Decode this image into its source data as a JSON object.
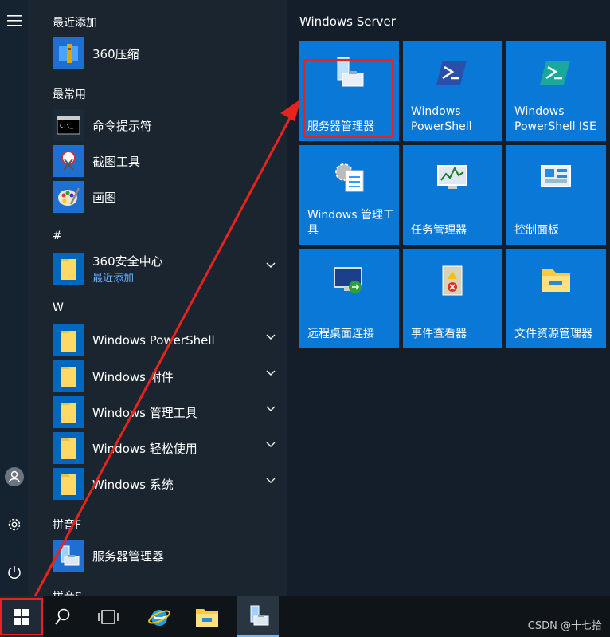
{
  "sidebar": {
    "icons": [
      "hamburger-icon",
      "user-icon",
      "gear-icon",
      "power-icon"
    ]
  },
  "applist": {
    "recent_header": "最近添加",
    "recent_items": [
      {
        "label": "360压缩",
        "icon": "archive-icon"
      }
    ],
    "most_used_header": "最常用",
    "most_used_items": [
      {
        "label": "命令提示符",
        "icon": "cmd-icon"
      },
      {
        "label": "截图工具",
        "icon": "snipping-icon"
      },
      {
        "label": "画图",
        "icon": "paint-icon"
      }
    ],
    "hash_header": "#",
    "hash_items": [
      {
        "label": "360安全中心",
        "sub": "最近添加"
      }
    ],
    "w_header": "W",
    "w_items": [
      {
        "label": "Windows PowerShell"
      },
      {
        "label": "Windows 附件"
      },
      {
        "label": "Windows 管理工具"
      },
      {
        "label": "Windows 轻松使用"
      },
      {
        "label": "Windows 系统"
      }
    ],
    "pinyin_f_header": "拼音F",
    "pinyin_f_items": [
      {
        "label": "服务器管理器"
      }
    ],
    "pinyin_s_header": "拼音S"
  },
  "tiles": {
    "group_title": "Windows Server",
    "items": [
      {
        "label": "服务器管理器",
        "icon": "server-manager-icon",
        "highlighted": true
      },
      {
        "label": "Windows PowerShell",
        "icon": "powershell-icon"
      },
      {
        "label": "Windows PowerShell ISE",
        "icon": "powershell-ise-icon"
      },
      {
        "label": "Windows 管理工具",
        "icon": "admin-tools-icon"
      },
      {
        "label": "任务管理器",
        "icon": "task-manager-icon"
      },
      {
        "label": "控制面板",
        "icon": "control-panel-icon"
      },
      {
        "label": "远程桌面连接",
        "icon": "remote-desktop-icon"
      },
      {
        "label": "事件查看器",
        "icon": "event-viewer-icon"
      },
      {
        "label": "文件资源管理器",
        "icon": "file-explorer-icon"
      }
    ]
  },
  "taskbar": {
    "icons": [
      "windows-start-icon",
      "search-icon",
      "task-view-icon",
      "ie-icon",
      "file-explorer-icon",
      "server-manager-icon"
    ]
  },
  "colors": {
    "tile_blue": "#0a78d7",
    "folder_yellow": "#ffd966",
    "annotation_red": "#e8231e"
  },
  "watermark": "CSDN @十七拾"
}
